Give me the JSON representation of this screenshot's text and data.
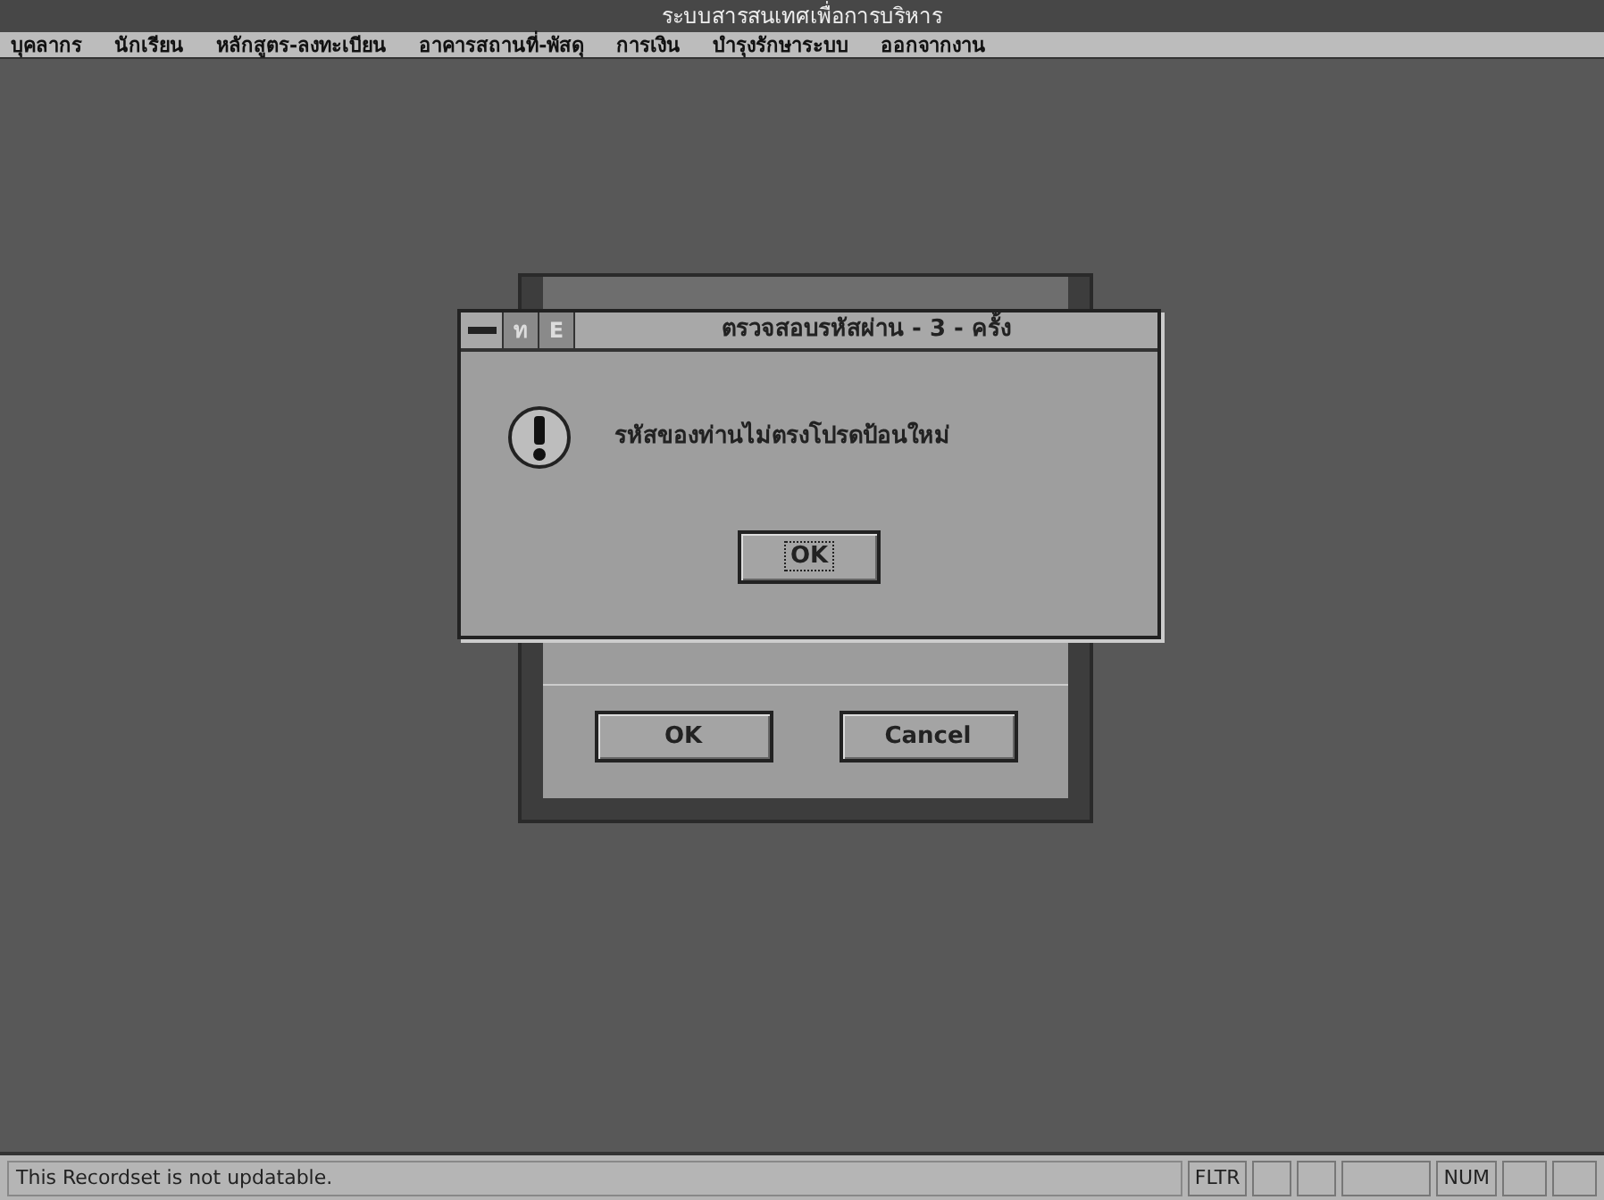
{
  "window": {
    "title": "ระบบสารสนเทศเพื่อการบริหาร"
  },
  "menu": [
    {
      "label": "บุคลากร"
    },
    {
      "label": "นักเรียน"
    },
    {
      "label": "หลักสูตร-ลงทะเบียน"
    },
    {
      "label": "อาคารสถานที่-พัสดุ"
    },
    {
      "label": "การเงิน"
    },
    {
      "label": "บำรุงรักษาระบบ"
    },
    {
      "label": "ออกจากงาน"
    }
  ],
  "back_dialog": {
    "buttons": [
      "OK",
      "Cancel"
    ]
  },
  "alert": {
    "title": "ตรวจสอบรหัสผ่าน - 3 - ครั้ง",
    "language_keys": [
      "ท",
      "E"
    ],
    "message": "รหัสของท่านไม่ตรงโปรดป้อนใหม่",
    "button": "OK"
  },
  "status_bar": {
    "message": "This Recordset is not updatable.",
    "indicators": [
      "FLTR",
      "NUM"
    ]
  }
}
